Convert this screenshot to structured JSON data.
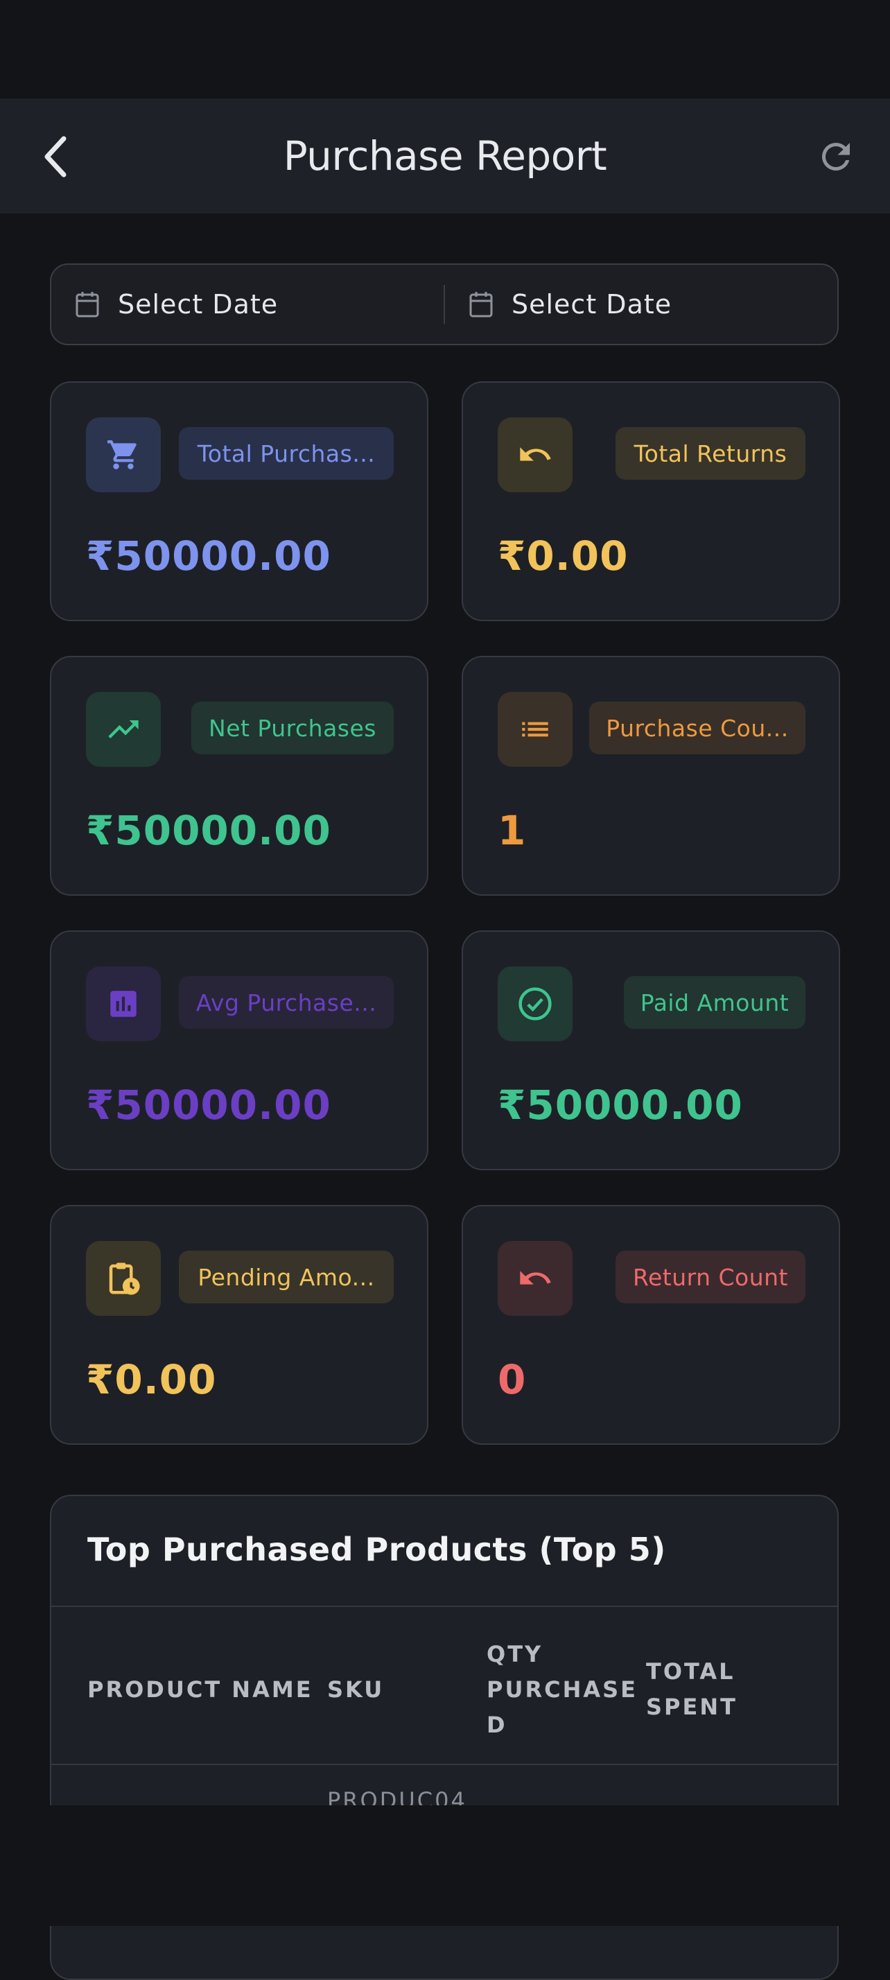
{
  "header": {
    "title": "Purchase Report"
  },
  "date_range": {
    "start_label": "Select Date",
    "end_label": "Select Date"
  },
  "cards": [
    {
      "label": "Total Purchas...",
      "value": "₹50000.00",
      "color": "#7d93ee",
      "icon": "cart-icon"
    },
    {
      "label": "Total Returns",
      "value": "₹0.00",
      "color": "#f1c35a",
      "icon": "undo-icon"
    },
    {
      "label": "Net Purchases",
      "value": "₹50000.00",
      "color": "#3fc48f",
      "icon": "trending-up-icon"
    },
    {
      "label": "Purchase Cou...",
      "value": "1",
      "color": "#ee9a3e",
      "icon": "list-icon"
    },
    {
      "label": "Avg Purchase...",
      "value": "₹50000.00",
      "color": "#6a3fc4",
      "icon": "bar-chart-icon"
    },
    {
      "label": "Paid Amount",
      "value": "₹50000.00",
      "color": "#3fc48f",
      "icon": "check-circle-icon"
    },
    {
      "label": "Pending Amo...",
      "value": "₹0.00",
      "color": "#f1c35a",
      "icon": "clipboard-clock-icon"
    },
    {
      "label": "Return Count",
      "value": "0",
      "color": "#ee6a6a",
      "icon": "undo-icon"
    }
  ],
  "top_products": {
    "title": "Top Purchased Products (Top 5)",
    "columns": [
      {
        "line1": "PRODUCT NAME"
      },
      {
        "line1": "SKU"
      },
      {
        "line1": "QTY",
        "line2": "PURCHASE",
        "line3": "D"
      },
      {
        "line1": "TOTAL",
        "line2": "SPENT"
      }
    ],
    "rows": [
      {
        "sku": "PRODUC04"
      }
    ]
  }
}
